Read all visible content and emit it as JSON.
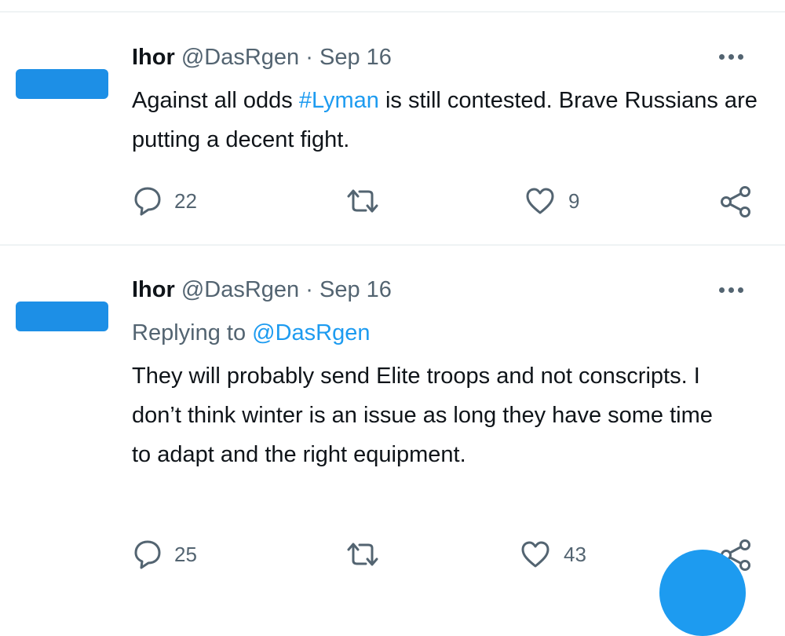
{
  "tweets": [
    {
      "name": "Ihor",
      "handle": "@DasRgen",
      "separator": "·",
      "date": "Sep 16",
      "text_before": "Against all odds ",
      "hashtag": "#Lyman",
      "text_after": " is still contested. Brave Russians are putting a decent fight.",
      "replies": "22",
      "likes": "9"
    },
    {
      "name": "Ihor",
      "handle": "@DasRgen",
      "separator": "·",
      "date": "Sep 16",
      "replying_prefix": "Replying to ",
      "replying_handle": "@DasRgen",
      "text": "They will probably send Elite troops and not conscripts. I don’t think winter is an issue as long they have some time to adapt and the right equipment.",
      "replies": "25",
      "likes": "43"
    }
  ],
  "colors": {
    "accent": "#1d9bf0",
    "avatar": "#1d8fe6",
    "muted": "#536471",
    "text": "#0f1419"
  },
  "icons": [
    "reply-icon",
    "retweet-icon",
    "like-icon",
    "share-icon",
    "more-icon"
  ]
}
